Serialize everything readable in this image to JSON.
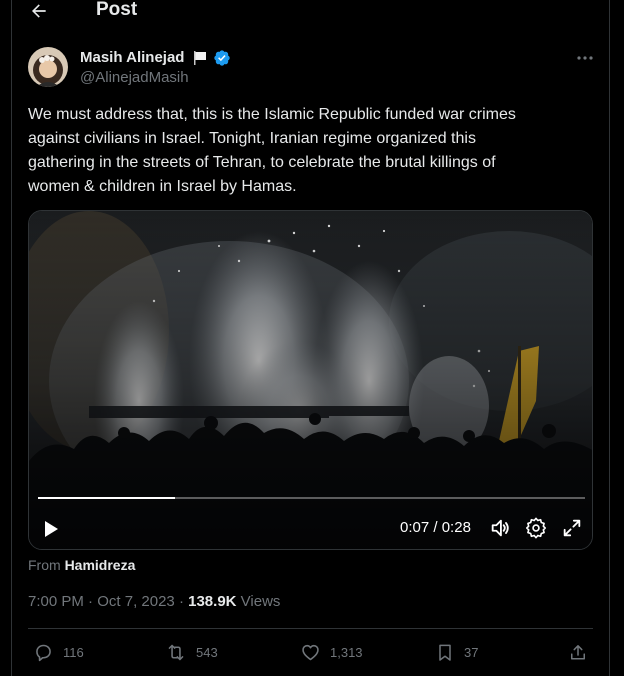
{
  "header": {
    "title": "Post"
  },
  "author": {
    "name": "Masih Alinejad",
    "handle": "@AlinejadMasih",
    "name_emoji": "white-flag-icon",
    "verified": true
  },
  "tweet": {
    "lines": [
      "We must address that, this is the Islamic Republic funded war crimes",
      "against civilians in Israel.  Tonight, Iranian regime organized this",
      "gathering in the streets of Tehran, to celebrate the brutal killings of",
      "women & children in Israel by Hamas."
    ]
  },
  "video": {
    "current_time": "0:07",
    "separator": " / ",
    "duration": "0:28",
    "progress_fraction": 0.25
  },
  "attribution": {
    "prefix": "From",
    "source": "Hamidreza"
  },
  "meta": {
    "time": "7:00 PM",
    "date": "Oct 7, 2023",
    "dot": "·",
    "views_count": "138.9K",
    "views_label": "Views"
  },
  "actions": {
    "replies": "116",
    "reposts": "543",
    "likes": "1,313",
    "bookmarks": "37"
  },
  "colors": {
    "background": "#000000",
    "text": "#e7e9ea",
    "muted": "#71767b",
    "border": "#2f3336",
    "verified": "#1d9bf0"
  },
  "icons": [
    "back-arrow-icon",
    "more-icon",
    "verified-icon",
    "play-icon",
    "volume-icon",
    "settings-icon",
    "fullscreen-icon",
    "reply-icon",
    "repost-icon",
    "like-icon",
    "bookmark-icon",
    "share-icon"
  ]
}
